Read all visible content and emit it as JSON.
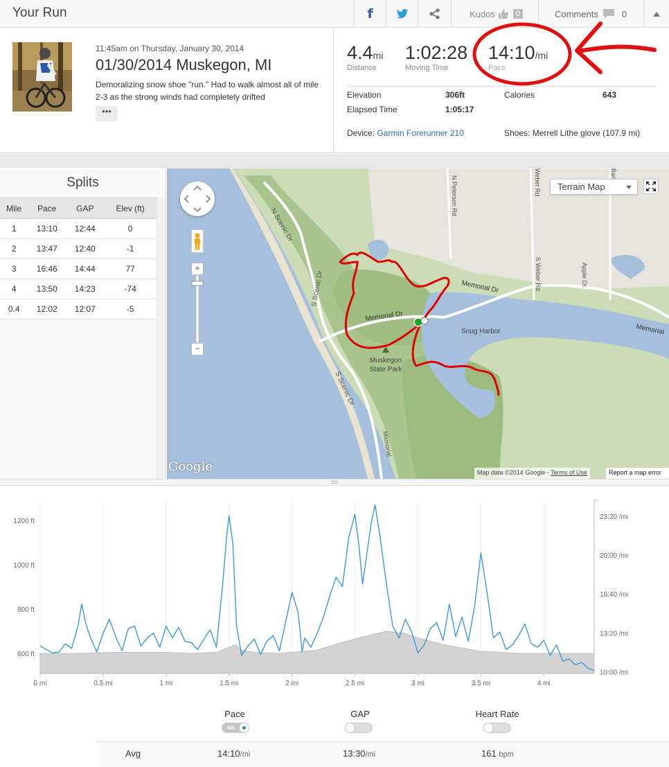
{
  "header": {
    "title": "Your Run",
    "kudos_label": "Kudos",
    "kudos_count": "0",
    "comments_label": "Comments",
    "comments_count": "0"
  },
  "activity": {
    "datetime": "11:45am on Thursday, January 30, 2014",
    "name": "01/30/2014 Muskegon, MI",
    "description": "Demoralizing snow shoe \"run.\" Had to walk almost all of mile 2-3 as the strong winds had completely drifted",
    "more_label": "•••"
  },
  "stats": {
    "distance_value": "4.4",
    "distance_unit": "mi",
    "distance_label": "Distance",
    "moving_value": "1:02:28",
    "moving_label": "Moving Time",
    "pace_value": "14:10",
    "pace_unit": "/mi",
    "pace_label": "Pace",
    "elevation_label": "Elevation",
    "elevation_value": "306ft",
    "calories_label": "Calories",
    "calories_value": "643",
    "elapsed_label": "Elapsed Time",
    "elapsed_value": "1:05:17",
    "device_label": "Device:",
    "device_value": "Garmin Forerunner 210",
    "shoes_label": "Shoes:",
    "shoes_value": "Merrell Lithe glove (107.9 mi)"
  },
  "splits": {
    "title": "Splits",
    "columns": [
      "Mile",
      "Pace",
      "GAP",
      "Elev (ft)"
    ],
    "rows": [
      [
        "1",
        "13:10",
        "12:44",
        "0"
      ],
      [
        "2",
        "13:47",
        "12:40",
        "-1"
      ],
      [
        "3",
        "16:46",
        "14:44",
        "77"
      ],
      [
        "4",
        "13:50",
        "14:23",
        "-74"
      ],
      [
        "0.4",
        "12:02",
        "12:07",
        "-5"
      ]
    ]
  },
  "map": {
    "terrain_label": "Terrain Map",
    "google_logo": "Google",
    "attribution": "Map data ©2014 Google - ",
    "terms": "Terms of Use",
    "report": "Report a map error",
    "labels": {
      "n_scenic": "N Scenic Dr",
      "s_scenic": "S Scenic Dr",
      "s_scenic2": "S Scenic Dr",
      "memorial1": "Memorial Dr",
      "memorial2": "Memorial Dr",
      "memorial3": "Memorial",
      "snug": "Snug Harbor",
      "park1": "Muskegon",
      "park2": "State Park",
      "n_peterson": "N Peterson Rd",
      "weber": "Weber Rd",
      "s_weber": "S Weber Rd",
      "memorial_v": "Memorial",
      "bark": "Bark Rd",
      "apple": "Apple Dr"
    }
  },
  "chart_data": {
    "type": "area",
    "x_ticks": [
      0,
      0.5,
      1,
      1.5,
      2,
      2.5,
      3,
      3.5,
      4
    ],
    "x_tick_labels": [
      "0 mi",
      "0.5 mi",
      "1 mi",
      "1.5 mi",
      "2 mi",
      "2.5 mi",
      "3 mi",
      "3.5 mi",
      "4 mi"
    ],
    "xlim": [
      0,
      4.4
    ],
    "left_axis": {
      "ticks": [
        600,
        800,
        1000,
        1200
      ],
      "tick_labels": [
        "600 ft",
        "800 ft",
        "1000 ft",
        "1200 ft"
      ],
      "ylim": [
        510,
        1290
      ]
    },
    "right_axis": {
      "tick_labels": [
        "10:00 /mi",
        "13:20 /mi",
        "16:40 /mi",
        "20:00 /mi",
        "23:20 /mi"
      ],
      "values_min_per_mi": [
        10,
        13.333,
        16.667,
        20,
        23.333
      ]
    },
    "series": [
      {
        "name": "Pace",
        "color": "#3a9ad9",
        "x": [
          0,
          0.05,
          0.1,
          0.15,
          0.2,
          0.25,
          0.3,
          0.33,
          0.36,
          0.4,
          0.45,
          0.5,
          0.55,
          0.6,
          0.65,
          0.7,
          0.75,
          0.8,
          0.85,
          0.9,
          0.95,
          1.0,
          1.05,
          1.1,
          1.15,
          1.2,
          1.25,
          1.3,
          1.35,
          1.4,
          1.45,
          1.48,
          1.5,
          1.53,
          1.56,
          1.6,
          1.65,
          1.7,
          1.75,
          1.8,
          1.85,
          1.9,
          1.95,
          2.0,
          2.05,
          2.08,
          2.1,
          2.15,
          2.2,
          2.25,
          2.3,
          2.35,
          2.4,
          2.45,
          2.5,
          2.53,
          2.56,
          2.6,
          2.63,
          2.66,
          2.7,
          2.75,
          2.8,
          2.85,
          2.9,
          2.95,
          3.0,
          3.05,
          3.1,
          3.15,
          3.2,
          3.25,
          3.3,
          3.35,
          3.4,
          3.45,
          3.5,
          3.55,
          3.6,
          3.65,
          3.7,
          3.75,
          3.8,
          3.85,
          3.9,
          3.95,
          4.0,
          4.05,
          4.1,
          4.15,
          4.2,
          4.25,
          4.3,
          4.35,
          4.4
        ],
        "y": [
          12.2,
          11.9,
          11.6,
          11.7,
          12.4,
          12.0,
          13.9,
          15.8,
          14.2,
          12.9,
          11.7,
          13.3,
          14.5,
          13.0,
          11.8,
          13.7,
          13.9,
          12.2,
          12.9,
          13.3,
          12.1,
          13.9,
          12.9,
          13.8,
          12.6,
          12.5,
          11.9,
          12.8,
          13.6,
          12.1,
          17.5,
          21.5,
          23.4,
          21.0,
          13.9,
          11.4,
          12.2,
          12.8,
          11.5,
          12.6,
          13.1,
          11.8,
          14.3,
          16.8,
          15.0,
          11.7,
          12.9,
          12.1,
          13.3,
          14.7,
          16.5,
          18.1,
          17.3,
          21.5,
          23.5,
          21.0,
          17.5,
          20.5,
          22.8,
          24.3,
          21.5,
          17.5,
          13.9,
          12.9,
          14.5,
          13.4,
          11.6,
          12.3,
          13.7,
          14.2,
          12.7,
          15.8,
          13.0,
          14.7,
          12.6,
          15.6,
          20.2,
          16.7,
          12.9,
          13.4,
          11.9,
          12.3,
          13.1,
          14.1,
          12.4,
          12.1,
          12.7,
          11.4,
          12.3,
          10.9,
          11.1,
          10.6,
          10.8,
          10.3,
          10.1
        ]
      },
      {
        "name": "Elevation",
        "color": "#d3d3d3",
        "x": [
          0,
          0.3,
          0.6,
          1.0,
          1.2,
          1.4,
          1.55,
          1.6,
          1.7,
          1.9,
          2.0,
          2.2,
          2.4,
          2.6,
          2.75,
          2.9,
          3.0,
          3.2,
          3.5,
          3.8,
          4.0,
          4.2,
          4.4
        ],
        "y": [
          600,
          600,
          605,
          605,
          600,
          605,
          640,
          615,
          605,
          600,
          605,
          615,
          650,
          680,
          700,
          690,
          670,
          640,
          610,
          600,
          600,
          600,
          600
        ]
      }
    ]
  },
  "toggles": {
    "pace_label": "Pace",
    "pace_on_text": "on",
    "gap_label": "GAP",
    "hr_label": "Heart Rate"
  },
  "averages": {
    "label": "Avg",
    "pace": "14:10",
    "pace_unit": "/mi",
    "gap": "13:30",
    "gap_unit": "/mi",
    "hr": "161",
    "hr_unit": "bpm"
  }
}
